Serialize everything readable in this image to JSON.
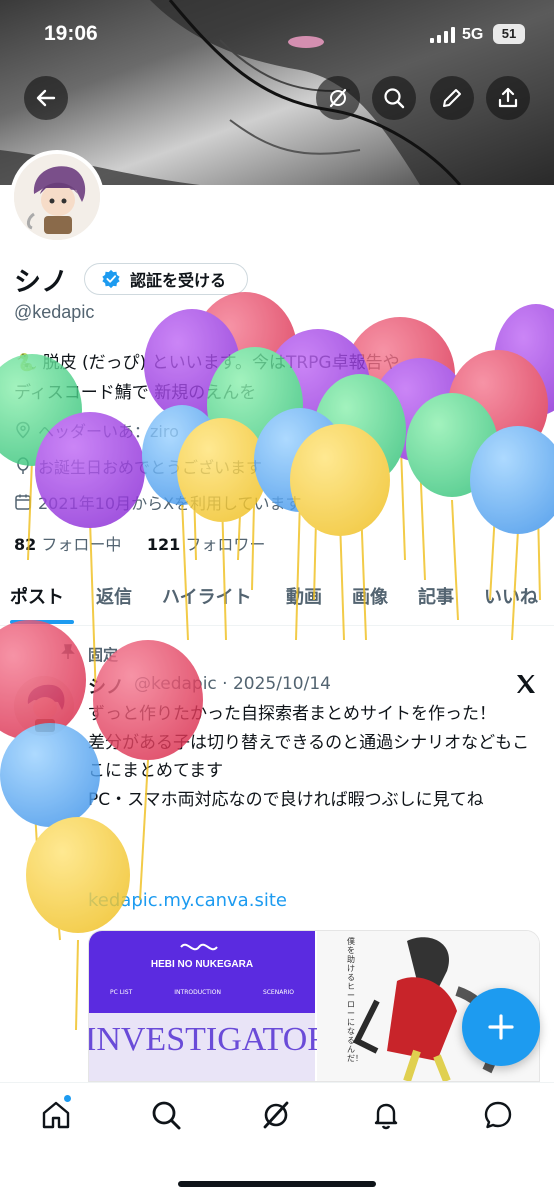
{
  "status_bar": {
    "time": "19:06",
    "network": "5G",
    "battery": "51"
  },
  "header": {
    "back_icon": "arrow-left-icon",
    "grok_icon": "grok-icon",
    "search_icon": "search-icon",
    "edit_icon": "pencil-icon",
    "share_icon": "share-icon"
  },
  "profile": {
    "display_name": "シノ",
    "verify_button_label": "認証を受ける",
    "handle": "@kedapic",
    "bio_line1": "🐍 脱皮 (だっぴ) といいます。今はTRPG卓報告や",
    "bio_line2": "ディスコード鯖で 新規のえんを",
    "location": "ヘッダーいあ：ziro",
    "birthday": "お誕生日おめでとうございます",
    "joined": "2021年10月からXを利用しています",
    "following_count": "82",
    "following_label": "フォロー中",
    "followers_count": "121",
    "followers_label": "フォロワー"
  },
  "tabs": [
    {
      "label": "ポスト"
    },
    {
      "label": "返信"
    },
    {
      "label": "ハイライト"
    },
    {
      "label": "動画"
    },
    {
      "label": "画像"
    },
    {
      "label": "記事"
    },
    {
      "label": "いいね"
    }
  ],
  "pinned_post": {
    "pin_label": "固定",
    "author_name": "シノ",
    "author_handle": "@kedapic · 2025/10/14",
    "text_lines": [
      "ずっと作りたかった自探索者まとめサイトを作った！",
      "差分がある子は切り替えできるのと通過シナリオなどもここにまとめてます",
      "PC・スマホ両対応なので良ければ暇つぶしに見てね"
    ],
    "link": "kedapic.my.canva.site",
    "media_left": {
      "brand": "HEBI NO NUKEGARA",
      "nav": [
        "PC LIST",
        "INTRODUCTION",
        "SCENARIO"
      ],
      "big_text": "INVESTIGATOR"
    },
    "media_right_caption": "僕を助けるヒーローになるんだ！"
  },
  "bottom_nav": [
    "home-icon",
    "search-icon",
    "grok-icon",
    "bell-icon",
    "mail-icon"
  ],
  "colors": {
    "accent": "#1d9bf0",
    "text": "#0f1419",
    "muted": "#536471"
  }
}
